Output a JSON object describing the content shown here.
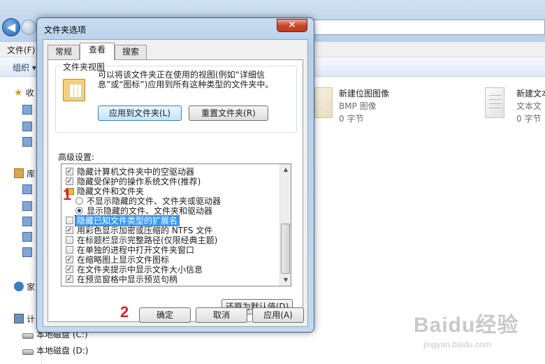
{
  "explorer": {
    "menu_file": "文件(F)",
    "organize": "组织",
    "organize_arrow": "▾",
    "nav": {
      "favorites": "收",
      "libraries": "库",
      "homegroup": "家",
      "computer": "计",
      "drive_c": "本地磁盘 (C:)",
      "drive_d": "本地磁盘 (D:)"
    },
    "files": [
      {
        "name": "新建位图图像",
        "type": "BMP 图像",
        "size": "0 字节"
      },
      {
        "name": "新建文本",
        "type": "文本文",
        "size": "0 字节"
      }
    ]
  },
  "dialog": {
    "title": "文件夹选项",
    "close_glyph": "✕",
    "tabs": [
      {
        "label": "常规",
        "active": false
      },
      {
        "label": "查看",
        "active": true
      },
      {
        "label": "搜索",
        "active": false
      }
    ],
    "folder_views": {
      "label": "文件夹视图",
      "description": "可以将该文件夹正在使用的视图(例如“详细信息”或“图标”)应用到所有这种类型的文件夹中。",
      "apply_button": "应用到文件夹(L)",
      "reset_button": "重置文件夹(R)"
    },
    "advanced_label": "高级设置:",
    "advanced_items": [
      {
        "text": "隐藏计算机文件夹中的空驱动器",
        "kind": "checkbox",
        "checked": true
      },
      {
        "text": "隐藏受保护的操作系统文件(推荐)",
        "kind": "checkbox",
        "checked": true
      },
      {
        "text": "隐藏文件和文件夹",
        "kind": "folder"
      },
      {
        "text": "不显示隐藏的文件、文件夹或驱动器",
        "kind": "radio",
        "checked": false
      },
      {
        "text": "显示隐藏的文件、文件夹和驱动器",
        "kind": "radio",
        "checked": true
      },
      {
        "text": "隐藏已知文件类型的扩展名",
        "kind": "checkbox",
        "checked": false,
        "selected": true
      },
      {
        "text": "用彩色显示加密或压缩的 NTFS 文件",
        "kind": "checkbox",
        "checked": true
      },
      {
        "text": "在标题栏显示完整路径(仅限经典主题)",
        "kind": "checkbox",
        "checked": false
      },
      {
        "text": "在单独的进程中打开文件夹窗口",
        "kind": "checkbox",
        "checked": false
      },
      {
        "text": "在缩略图上显示文件图标",
        "kind": "checkbox",
        "checked": true
      },
      {
        "text": "在文件夹提示中显示文件大小信息",
        "kind": "checkbox",
        "checked": true
      },
      {
        "text": "在预览窗格中显示预览句柄",
        "kind": "checkbox",
        "checked": true
      }
    ],
    "restore_defaults": "还原为默认值(D)",
    "ok": "确定",
    "cancel": "取消",
    "apply": "应用(A)"
  },
  "annotations": {
    "step1": "1",
    "step2": "2"
  },
  "watermark": {
    "logo": "Baidu经验",
    "url": "jingyan.baidu.com"
  },
  "colors": {
    "selection": "#3399ff",
    "step_marker": "#d8232a",
    "dialog_frame": "#b6d0ea"
  }
}
